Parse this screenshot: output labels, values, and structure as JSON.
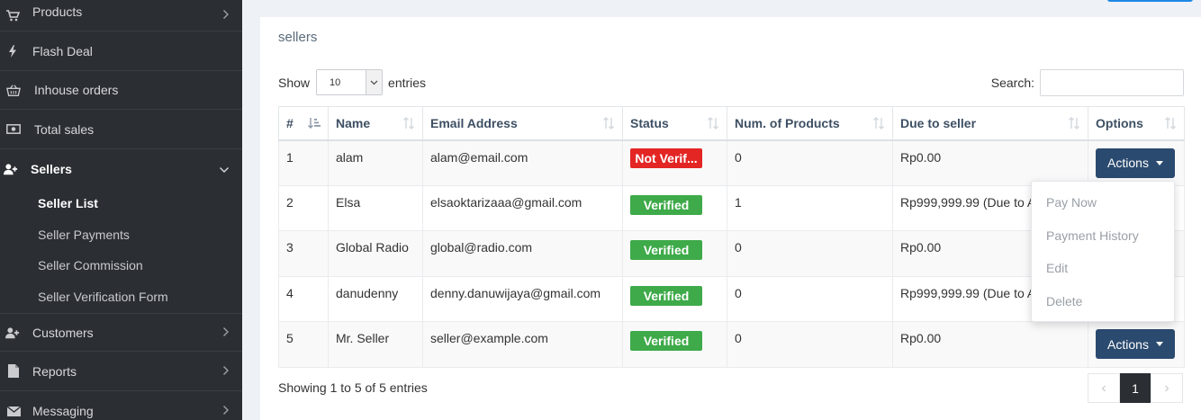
{
  "sidebar": {
    "items": [
      {
        "label": "Products",
        "icon": "cart-icon",
        "has_children": true
      },
      {
        "label": "Flash Deal",
        "icon": "bolt-icon",
        "has_children": false
      },
      {
        "label": "Inhouse orders",
        "icon": "basket-icon",
        "has_children": false
      },
      {
        "label": "Total sales",
        "icon": "money-icon",
        "has_children": false
      },
      {
        "label": "Sellers",
        "icon": "user-plus-icon",
        "has_children": true,
        "expanded": true
      },
      {
        "label": "Customers",
        "icon": "user-plus-icon",
        "has_children": true
      },
      {
        "label": "Reports",
        "icon": "file-icon",
        "has_children": true
      },
      {
        "label": "Messaging",
        "icon": "envelope-icon",
        "has_children": true
      }
    ],
    "sellers_sub": [
      {
        "label": "Seller List",
        "active": true
      },
      {
        "label": "Seller Payments"
      },
      {
        "label": "Seller Commission"
      },
      {
        "label": "Seller Verification Form"
      }
    ]
  },
  "panel": {
    "title": "sellers",
    "show_label": "Show",
    "entries_value": "10",
    "entries_label": "entries",
    "search_label": "Search:",
    "search_value": ""
  },
  "table": {
    "columns": [
      "#",
      "Name",
      "Email Address",
      "Status",
      "Num. of Products",
      "Due to seller",
      "Options"
    ],
    "rows": [
      {
        "num": "1",
        "name": "alam",
        "email": "alam@email.com",
        "status": "Not Verif...",
        "status_type": "not-verified",
        "products": "0",
        "due": "Rp0.00",
        "has_button": true
      },
      {
        "num": "2",
        "name": "Elsa",
        "email": "elsaoktarizaaa@gmail.com",
        "status": "Verified",
        "status_type": "verified",
        "products": "1",
        "due": "Rp999,999.99 (Due to Admin)",
        "has_button": false
      },
      {
        "num": "3",
        "name": "Global Radio",
        "email": "global@radio.com",
        "status": "Verified",
        "status_type": "verified",
        "products": "0",
        "due": "Rp0.00",
        "has_button": false
      },
      {
        "num": "4",
        "name": "danudenny",
        "email": "denny.danuwijaya@gmail.com",
        "status": "Verified",
        "status_type": "verified",
        "products": "0",
        "due": "Rp999,999.99 (Due to Admin)",
        "has_button": false
      },
      {
        "num": "5",
        "name": "Mr. Seller",
        "email": "seller@example.com",
        "status": "Verified",
        "status_type": "verified",
        "products": "0",
        "due": "Rp0.00",
        "has_button": true
      }
    ],
    "actions_label": "Actions"
  },
  "dropdown": {
    "items": [
      "Pay Now",
      "Payment History",
      "Edit",
      "Delete"
    ]
  },
  "footer": {
    "info": "Showing 1 to 5 of 5 entries",
    "prev": "‹",
    "current_page": "1",
    "next": "›"
  },
  "colors": {
    "sidebar_bg": "#2b2e33",
    "verified": "#3eaa49",
    "not_verified": "#e32524",
    "actions_button": "#2b4a6f",
    "accent": "#1e88e5"
  }
}
